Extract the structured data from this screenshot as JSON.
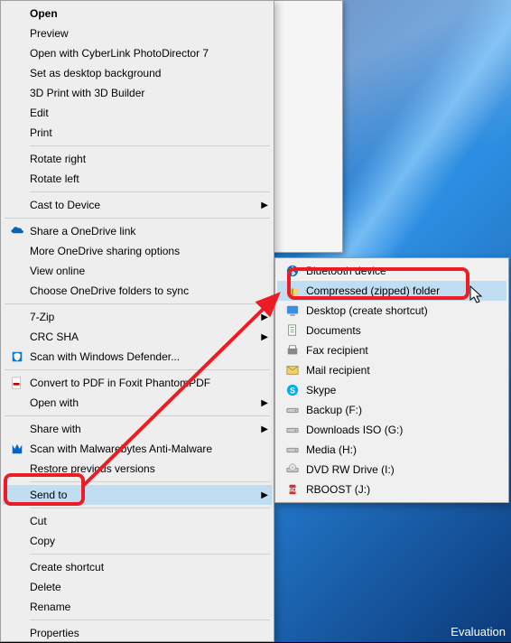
{
  "menu": {
    "open": "Open",
    "preview": "Preview",
    "cyberlink": "Open with CyberLink PhotoDirector 7",
    "setbg": "Set as desktop background",
    "print3d": "3D Print with 3D Builder",
    "edit": "Edit",
    "print": "Print",
    "rotr": "Rotate right",
    "rotl": "Rotate left",
    "cast": "Cast to Device",
    "share_onedrive": "Share a OneDrive link",
    "more_onedrive": "More OneDrive sharing options",
    "view_online": "View online",
    "choose_onedrive": "Choose OneDrive folders to sync",
    "sevenzip": "7-Zip",
    "crcsha": "CRC SHA",
    "defender": "Scan with Windows Defender...",
    "foxit": "Convert to PDF in Foxit PhantomPDF",
    "openwith": "Open with",
    "sharewith": "Share with",
    "mbam": "Scan with Malwarebytes Anti-Malware",
    "restoreprev": "Restore previous versions",
    "sendto": "Send to",
    "cut": "Cut",
    "copy": "Copy",
    "shortcut": "Create shortcut",
    "delete": "Delete",
    "rename": "Rename",
    "properties": "Properties"
  },
  "submenu": {
    "bluetooth": "Bluetooth device",
    "compressed": "Compressed (zipped) folder",
    "desktop": "Desktop (create shortcut)",
    "documents": "Documents",
    "fax": "Fax recipient",
    "mail": "Mail recipient",
    "skype": "Skype",
    "backup": "Backup (F:)",
    "downloads": "Downloads  ISO (G:)",
    "media": "Media (H:)",
    "dvdrw": "DVD RW Drive (I:)",
    "rboost": "RBOOST (J:)"
  },
  "watermark": "Evaluation"
}
